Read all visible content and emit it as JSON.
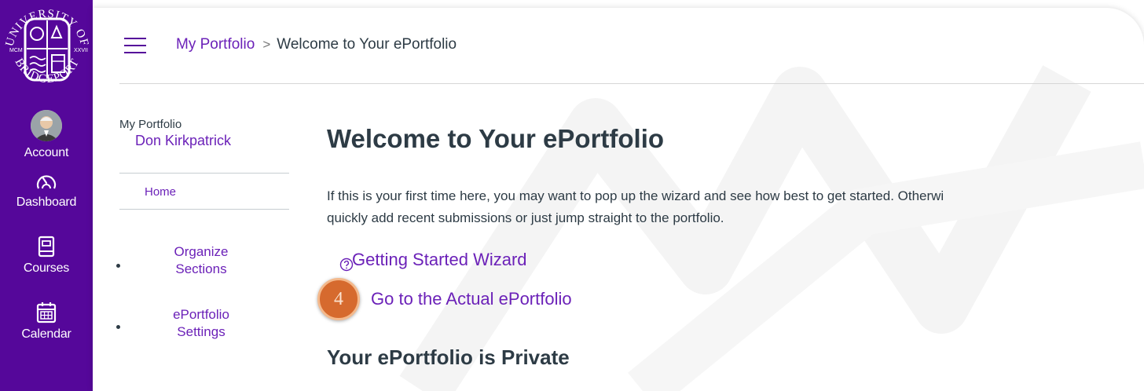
{
  "global_nav": {
    "logo_alt": "University of Bridgeport",
    "items": [
      {
        "label": "Account",
        "icon": "avatar"
      },
      {
        "label": "Dashboard",
        "icon": "dashboard-icon"
      },
      {
        "label": "Courses",
        "icon": "courses-icon"
      },
      {
        "label": "Calendar",
        "icon": "calendar-icon"
      }
    ],
    "colors": {
      "background": "#55079a",
      "text": "#ffffff"
    }
  },
  "breadcrumb": {
    "items": [
      "My Portfolio",
      "Welcome to Your ePortfolio"
    ],
    "separator": ">"
  },
  "sidebar": {
    "title": "My Portfolio",
    "user_name": "Don Kirkpatrick",
    "home": "Home",
    "links": [
      "Organize Sections",
      "ePortfolio Settings"
    ]
  },
  "main": {
    "title": "Welcome to Your ePortfolio",
    "intro_line1": "If this is your first time here, you may want to pop up the wizard and see how best to get started. Otherwi",
    "intro_line2": "quickly add recent submissions or just jump straight to the portfolio.",
    "wizard_link": "Getting Started Wizard",
    "actual_link": "Go to the Actual ePortfolio",
    "step_badge": "4",
    "subheading": "Your ePortfolio is Private"
  },
  "colors": {
    "link": "#6b21b8",
    "text": "#2d3b45",
    "badge": "#d66a2e"
  }
}
